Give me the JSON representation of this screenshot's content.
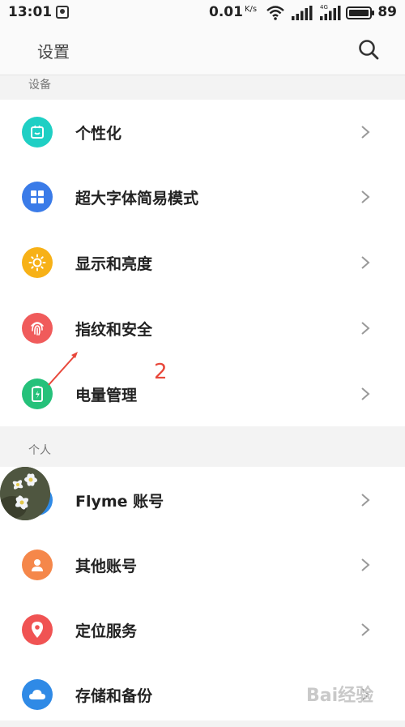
{
  "status_bar": {
    "time": "13:01",
    "net_speed": "0.01",
    "net_speed_unit": "K/s",
    "battery": "89"
  },
  "header": {
    "title": "设置"
  },
  "sections": [
    {
      "label": "设备",
      "items": [
        {
          "label": "个性化",
          "icon": "personalization-icon",
          "color": "#1fcfc4"
        },
        {
          "label": "超大字体简易模式",
          "icon": "grid-icon",
          "color": "#3a7be8"
        },
        {
          "label": "显示和亮度",
          "icon": "sun-icon",
          "color": "#f7b117"
        },
        {
          "label": "指纹和安全",
          "icon": "fingerprint-icon",
          "color": "#f05b5b"
        },
        {
          "label": "电量管理",
          "icon": "battery-icon",
          "color": "#25c17a"
        }
      ]
    },
    {
      "label": "个人",
      "items": [
        {
          "label": "Flyme 账号",
          "icon": "account-icon",
          "color": "#2f8ae6"
        },
        {
          "label": "其他账号",
          "icon": "user-icon",
          "color": "#f5874a"
        },
        {
          "label": "定位服务",
          "icon": "location-pin-icon",
          "color": "#f05353"
        },
        {
          "label": "存储和备份",
          "icon": "cloud-icon",
          "color": "#2f8ae6"
        }
      ]
    }
  ],
  "annotation": {
    "number": "2"
  },
  "watermark": "Bai经验"
}
